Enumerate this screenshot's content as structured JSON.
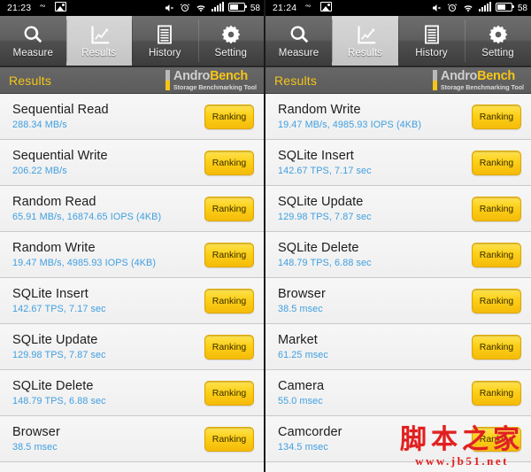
{
  "colors": {
    "accent_yellow": "#f5c518",
    "value_blue": "#3f9fe0",
    "tabbar_gray": "#5e5e5e",
    "row_bg": "#f2f2f2",
    "watermark_red": "#e02020"
  },
  "panels": [
    {
      "id": "left",
      "statusbar": {
        "time": "21:23",
        "battery_percent": "58",
        "left_icons": [
          "infinity-icon",
          "image-icon"
        ],
        "right_icons": [
          "mute-icon",
          "alarm-clock-icon",
          "wifi-icon",
          "signal-bars-icon",
          "battery-icon"
        ]
      },
      "tabs": [
        {
          "label": "Measure",
          "icon": "search-icon",
          "selected": false
        },
        {
          "label": "Results",
          "icon": "chart-icon",
          "selected": true
        },
        {
          "label": "History",
          "icon": "list-document-icon",
          "selected": false
        },
        {
          "label": "Setting",
          "icon": "gear-icon",
          "selected": false
        }
      ],
      "header": {
        "title": "Results",
        "brand_primary": "Andro",
        "brand_secondary": "Bench",
        "brand_subtitle": "Storage Benchmarking Tool"
      },
      "rows": [
        {
          "title": "Sequential Read",
          "value": "288.34 MB/s",
          "button": "Ranking"
        },
        {
          "title": "Sequential Write",
          "value": "206.22 MB/s",
          "button": "Ranking"
        },
        {
          "title": "Random Read",
          "value": "65.91 MB/s, 16874.65 IOPS (4KB)",
          "button": "Ranking"
        },
        {
          "title": "Random Write",
          "value": "19.47 MB/s, 4985.93 IOPS (4KB)",
          "button": "Ranking"
        },
        {
          "title": "SQLite Insert",
          "value": "142.67 TPS, 7.17 sec",
          "button": "Ranking"
        },
        {
          "title": "SQLite Update",
          "value": "129.98 TPS, 7.87 sec",
          "button": "Ranking"
        },
        {
          "title": "SQLite Delete",
          "value": "148.79 TPS, 6.88 sec",
          "button": "Ranking"
        },
        {
          "title": "Browser",
          "value": "38.5 msec",
          "button": "Ranking"
        }
      ]
    },
    {
      "id": "right",
      "statusbar": {
        "time": "21:24",
        "battery_percent": "58",
        "left_icons": [
          "infinity-icon",
          "image-icon"
        ],
        "right_icons": [
          "mute-icon",
          "alarm-clock-icon",
          "wifi-icon",
          "signal-bars-icon",
          "battery-icon"
        ]
      },
      "tabs": [
        {
          "label": "Measure",
          "icon": "search-icon",
          "selected": false
        },
        {
          "label": "Results",
          "icon": "chart-icon",
          "selected": true
        },
        {
          "label": "History",
          "icon": "list-document-icon",
          "selected": false
        },
        {
          "label": "Setting",
          "icon": "gear-icon",
          "selected": false
        }
      ],
      "header": {
        "title": "Results",
        "brand_primary": "Andro",
        "brand_secondary": "Bench",
        "brand_subtitle": "Storage Benchmarking Tool"
      },
      "rows": [
        {
          "title": "Random Write",
          "value": "19.47 MB/s, 4985.93 IOPS (4KB)",
          "button": "Ranking"
        },
        {
          "title": "SQLite Insert",
          "value": "142.67 TPS, 7.17 sec",
          "button": "Ranking"
        },
        {
          "title": "SQLite Update",
          "value": "129.98 TPS, 7.87 sec",
          "button": "Ranking"
        },
        {
          "title": "SQLite Delete",
          "value": "148.79 TPS, 6.88 sec",
          "button": "Ranking"
        },
        {
          "title": "Browser",
          "value": "38.5 msec",
          "button": "Ranking"
        },
        {
          "title": "Market",
          "value": "61.25 msec",
          "button": "Ranking"
        },
        {
          "title": "Camera",
          "value": "55.0 msec",
          "button": "Ranking"
        },
        {
          "title": "Camcorder",
          "value": "134.5 msec",
          "button": "Ranking"
        }
      ]
    }
  ],
  "watermark": {
    "text_cn": "脚本之家",
    "url": "www.jb51.net"
  }
}
